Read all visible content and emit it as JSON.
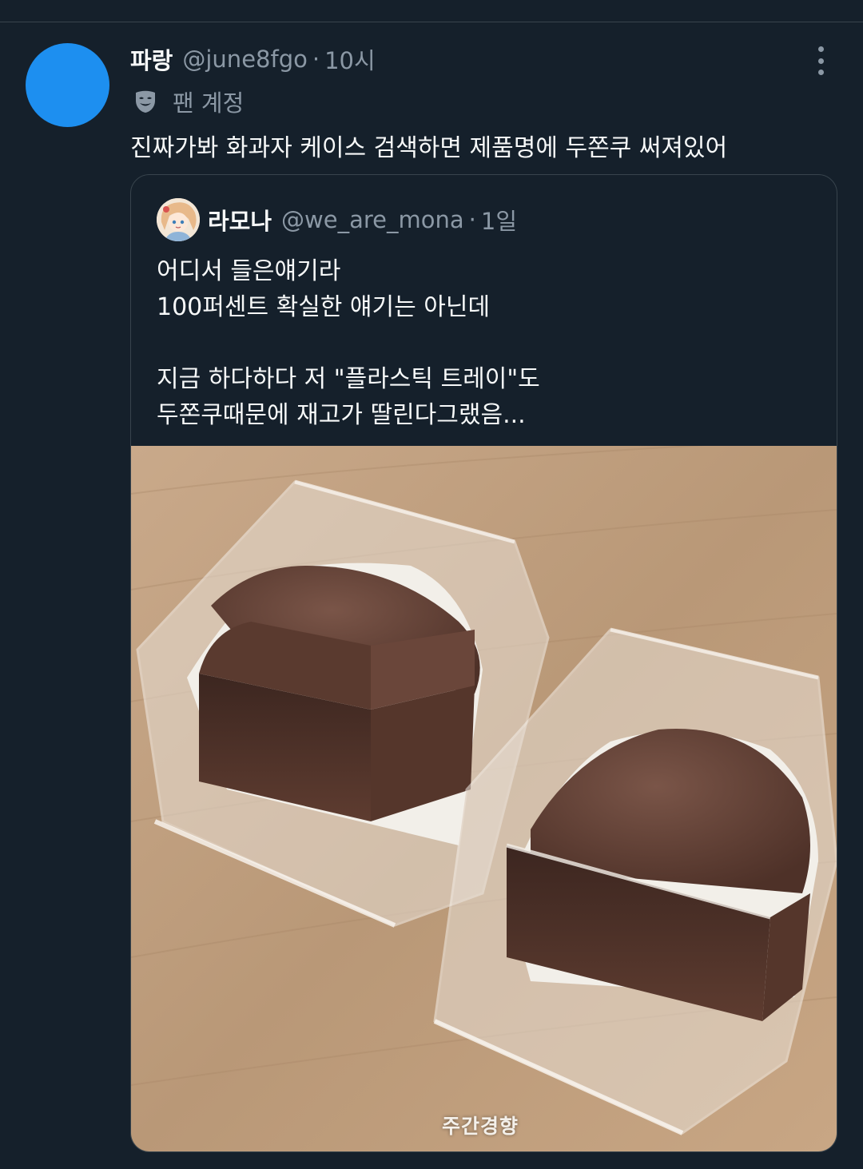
{
  "tweet": {
    "author_name": "파랑",
    "author_handle": "@june8fgo",
    "separator": "·",
    "time": "10시",
    "badge_label": "팬 계정",
    "badge_icon": "theater-mask-icon",
    "text": "진짜가봐 화과자 케이스 검색하면 제품명에 두쫀쿠 써져있어",
    "avatar_color": "#1d8ff0"
  },
  "quoted_tweet": {
    "author_name": "라모나",
    "author_handle": "@we_are_mona",
    "separator": "·",
    "time": "1일",
    "lines": [
      "어디서 들은얘기라",
      "100퍼센트 확실한 얘기는 아닌데",
      "",
      "지금 하다하다 저 \"플라스틱 트레이\"도",
      "두쫀쿠때문에 재고가 딸린다그랬음..."
    ],
    "image": {
      "description_icon": "photo-two-chocolate-cookies-in-plastic-trays",
      "watermark": "주간경향"
    }
  },
  "theme": {
    "background": "#15202b",
    "text": "#f7f9f9",
    "muted": "#8b98a5",
    "border": "#38444d"
  }
}
